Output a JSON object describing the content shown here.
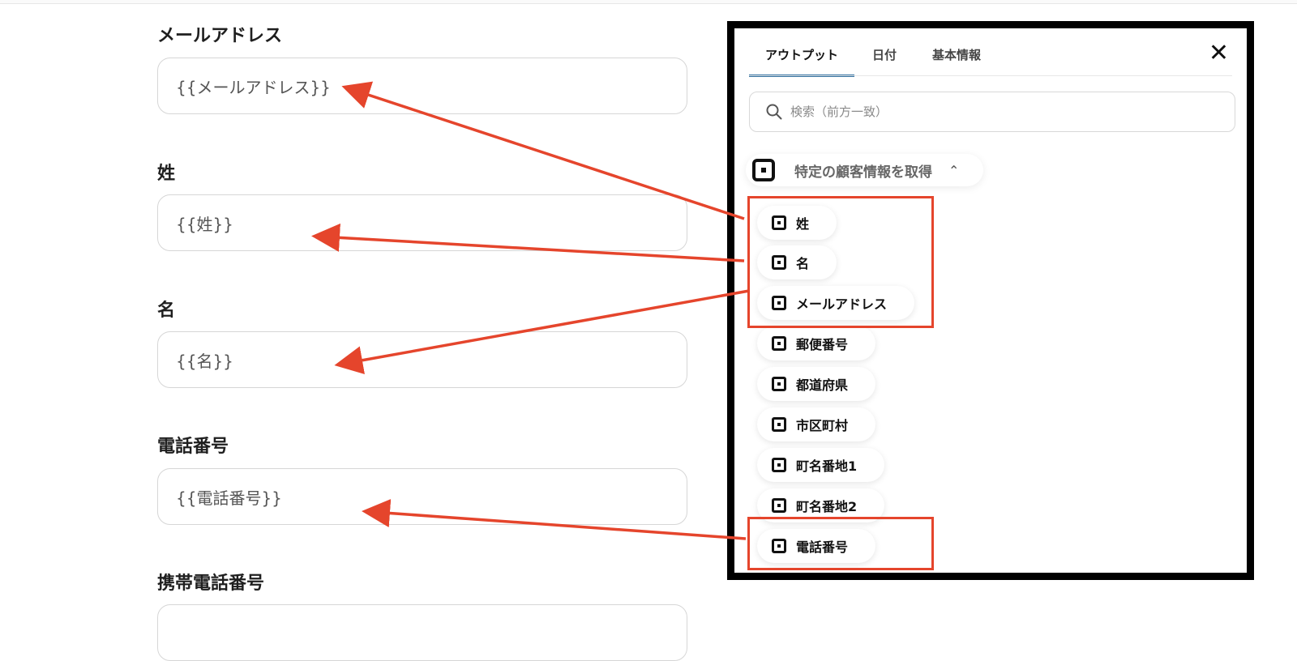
{
  "form": {
    "fields": [
      {
        "label": "メールアドレス",
        "value": "{{メールアドレス}}"
      },
      {
        "label": "姓",
        "value": "{{姓}}"
      },
      {
        "label": "名",
        "value": "{{名}}"
      },
      {
        "label": "電話番号",
        "value": "{{電話番号}}"
      },
      {
        "label": "携帯電話番号",
        "value": ""
      }
    ]
  },
  "panel": {
    "tabs": [
      "アウトプット",
      "日付",
      "基本情報"
    ],
    "active_tab": "アウトプット",
    "search": {
      "placeholder": "検索（前方一致）"
    },
    "group": {
      "title": "特定の顧客情報を取得",
      "icon": "square-logo-icon"
    },
    "items": [
      "姓",
      "名",
      "メールアドレス",
      "郵便番号",
      "都道府県",
      "市区町村",
      "町名番地1",
      "町名番地2",
      "電話番号"
    ]
  },
  "colors": {
    "accent": "#2f6f9f",
    "annotation": "#e5452c"
  }
}
